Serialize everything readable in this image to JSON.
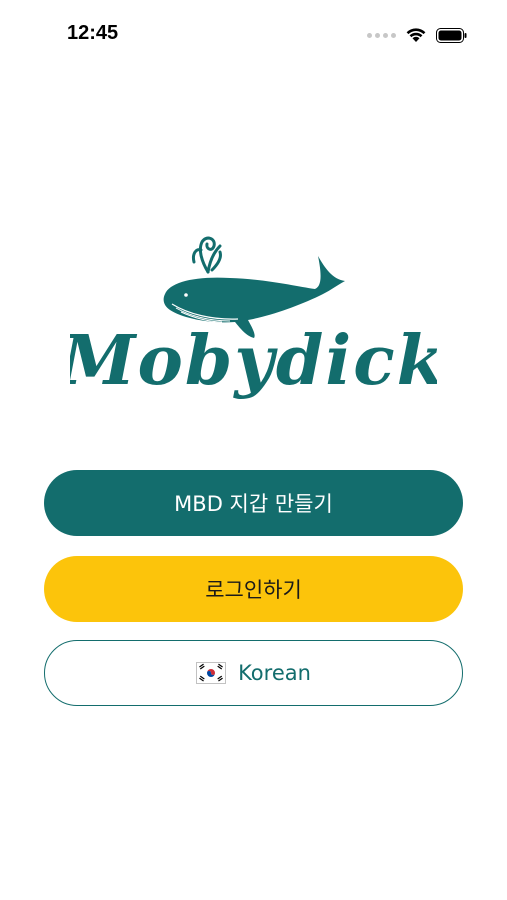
{
  "status_bar": {
    "time": "12:45"
  },
  "logo": {
    "wordmark": "Mobydick"
  },
  "buttons": {
    "create_wallet": "MBD 지갑 만들기",
    "login": "로그인하기",
    "language": "Korean"
  },
  "colors": {
    "brand_teal": "#136d6d",
    "brand_yellow": "#fcc40b",
    "background": "#ffffff"
  },
  "icons": {
    "language_flag": "south-korea-flag-icon"
  }
}
